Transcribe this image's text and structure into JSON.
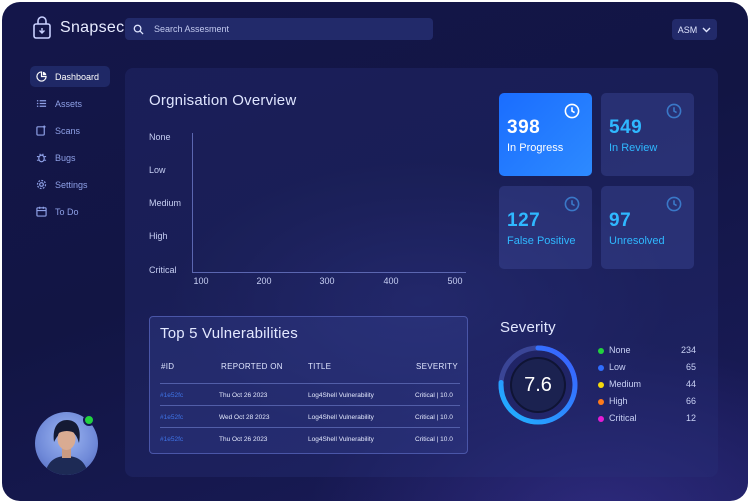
{
  "app": {
    "name": "Snapsec"
  },
  "search": {
    "placeholder": "Search Assesment"
  },
  "workspace": {
    "label": "ASM"
  },
  "sidebar": {
    "items": [
      {
        "label": "Dashboard",
        "icon": "dashboard-icon",
        "active": true
      },
      {
        "label": "Assets",
        "icon": "list-icon"
      },
      {
        "label": "Scans",
        "icon": "scan-icon"
      },
      {
        "label": "Bugs",
        "icon": "bug-icon"
      },
      {
        "label": "Settings",
        "icon": "gear-icon"
      },
      {
        "label": "To Do",
        "icon": "calendar-icon"
      }
    ]
  },
  "overview": {
    "title": "Orgnisation Overview",
    "y_labels": [
      "None",
      "Low",
      "Medium",
      "High",
      "Critical"
    ],
    "x_labels": [
      "100",
      "200",
      "300",
      "400",
      "500"
    ]
  },
  "stats": [
    {
      "value": "398",
      "label": "In Progress",
      "highlighted": true
    },
    {
      "value": "549",
      "label": "In Review"
    },
    {
      "value": "127",
      "label": "False Positive"
    },
    {
      "value": "97",
      "label": "Unresolved"
    }
  ],
  "vulnerabilities": {
    "title": "Top 5 Vulnerabilities",
    "headers": {
      "id": "#ID",
      "reported": "REPORTED ON",
      "title": "TITLE",
      "severity": "SEVERITY"
    },
    "rows": [
      {
        "id": "#1e52fc",
        "reported": "Thu Oct 26 2023",
        "title": "Log4Shell Vulnerability",
        "severity": "Critical | 10.0"
      },
      {
        "id": "#1e52fc",
        "reported": "Wed Oct 28 2023",
        "title": "Log4Shell Vulnerability",
        "severity": "Critical | 10.0"
      },
      {
        "id": "#1e52fc",
        "reported": "Thu Oct 26 2023",
        "title": "Log4Shell Vulnerability",
        "severity": "Critical | 10.0"
      }
    ]
  },
  "severity": {
    "title": "Severity",
    "score": "7.6",
    "score_fraction": 0.76,
    "items": [
      {
        "name": "None",
        "count": "234",
        "color": "#22d23e"
      },
      {
        "name": "Low",
        "count": "65",
        "color": "#2f6dff"
      },
      {
        "name": "Medium",
        "count": "44",
        "color": "#f5d90c"
      },
      {
        "name": "High",
        "count": "66",
        "color": "#ff7a1a"
      },
      {
        "name": "Critical",
        "count": "12",
        "color": "#e51bd6"
      }
    ]
  },
  "colors": {
    "accent": "#2f8cff",
    "stat_text": "#2fb8ff",
    "online": "#22d23e"
  }
}
